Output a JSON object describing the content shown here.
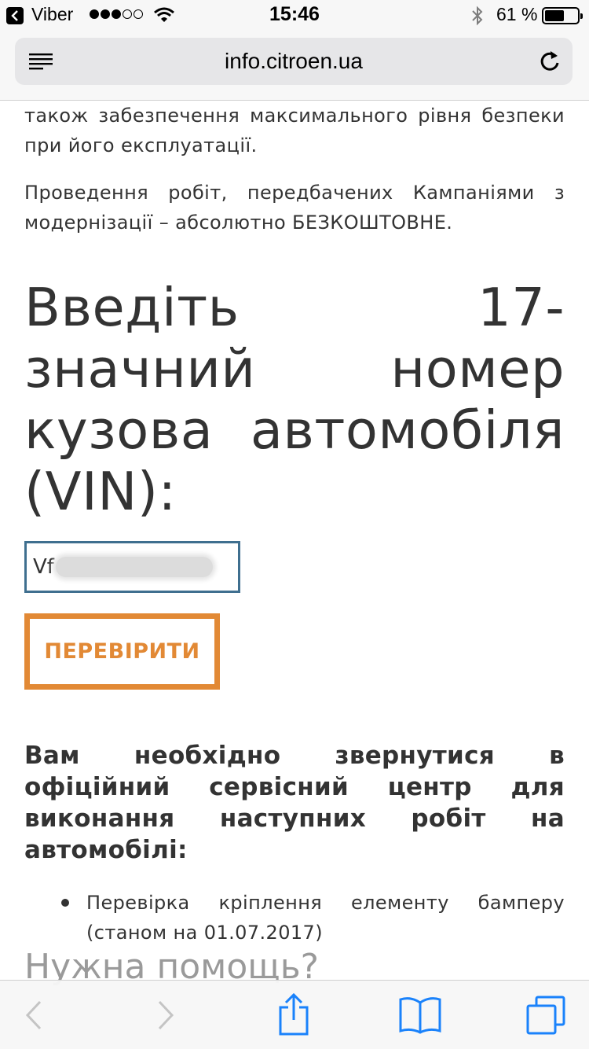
{
  "status_bar": {
    "back_app": "Viber",
    "signal_bars_on": 3,
    "signal_bars_total": 5,
    "time": "15:46",
    "battery_percent": "61 %",
    "battery_level": 0.61
  },
  "address_bar": {
    "url": "info.citroen.ua"
  },
  "content": {
    "paragraph_1": "також забезпечення максимального рівня безпеки при його експлуатації.",
    "paragraph_2": "Проведення робіт, передбачених Кампаніями з модернізації – абсолютно БЕЗКОШТОВНЕ.",
    "vin_heading": "Введіть 17-значний номер кузова автомобіля (VIN):",
    "vin_input_value": "Vf",
    "check_button_label": "ПЕРЕВІРИТИ",
    "service_heading": "Вам необхідно звернутися в офіційний сервісний центр для виконання наступних робіт на автомобілі:",
    "works": [
      "Перевірка кріплення елементу бамперу (станом на 01.07.2017)"
    ],
    "help_heading": "Нужна помощь?"
  },
  "colors": {
    "accent_orange": "#e28935",
    "input_border_blue": "#3f6f8f",
    "ios_blue": "#1a82fb",
    "text": "#333333"
  },
  "icons": {
    "status": [
      "back-to-app-icon",
      "wifi-icon",
      "bluetooth-icon",
      "battery-icon"
    ],
    "address": [
      "reader-menu-icon",
      "reload-icon"
    ],
    "toolbar": [
      "back-arrow-icon",
      "forward-arrow-icon",
      "share-icon",
      "bookmarks-icon",
      "tabs-icon"
    ]
  }
}
